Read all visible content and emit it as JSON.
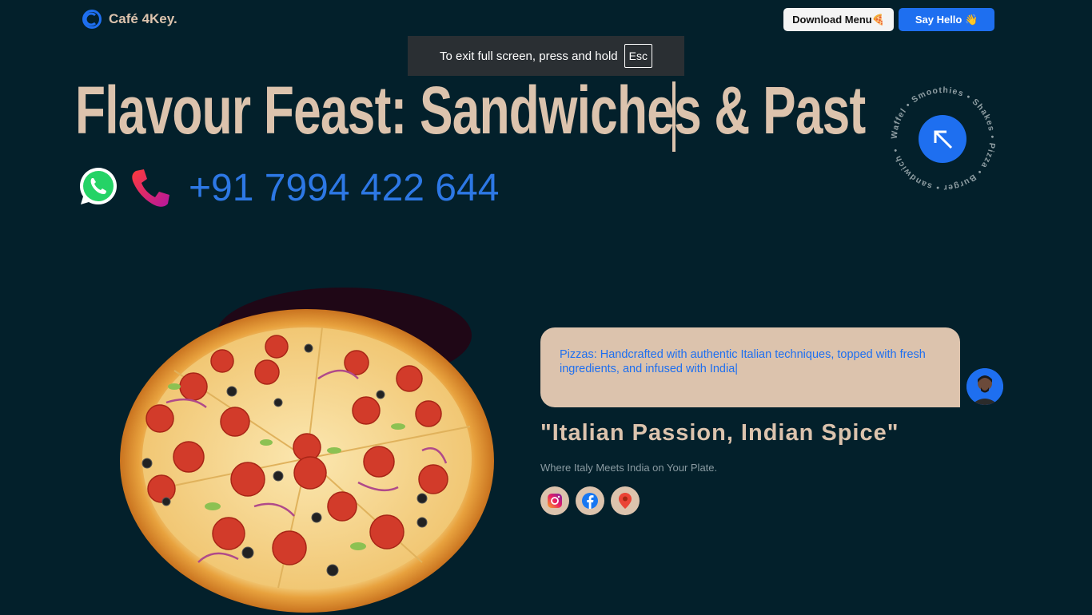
{
  "header": {
    "brand_name": "Café 4Key.",
    "download_button": "Download Menu🍕",
    "hello_button": "Say Hello 👋"
  },
  "toast": {
    "message": "To exit full screen, press and hold",
    "key": "Esc"
  },
  "hero": {
    "title": "Flavour Feast: Sandwiches & Past",
    "phone": "+91 7994 422 644"
  },
  "badge": {
    "ring_text": "Waffel • Smoothies • Shakes • Pizza • Burger • sandwich •"
  },
  "chat": {
    "message": "Pizzas: Handcrafted with authentic Italian techniques, topped with fresh ingredients, and infused with India|"
  },
  "promo": {
    "tagline": "\"Italian Passion, Indian Spice\"",
    "subline": "Where Italy Meets India on Your Plate."
  },
  "colors": {
    "background": "#03202b",
    "accent_beige": "#dcc3ad",
    "accent_blue": "#1e6ff0",
    "phone_blue": "#2d78e5"
  },
  "icons": [
    "brand-logo-icon",
    "whatsapp-icon",
    "phone-icon",
    "arrow-up-left-icon",
    "instagram-icon",
    "facebook-icon",
    "location-pin-icon"
  ]
}
